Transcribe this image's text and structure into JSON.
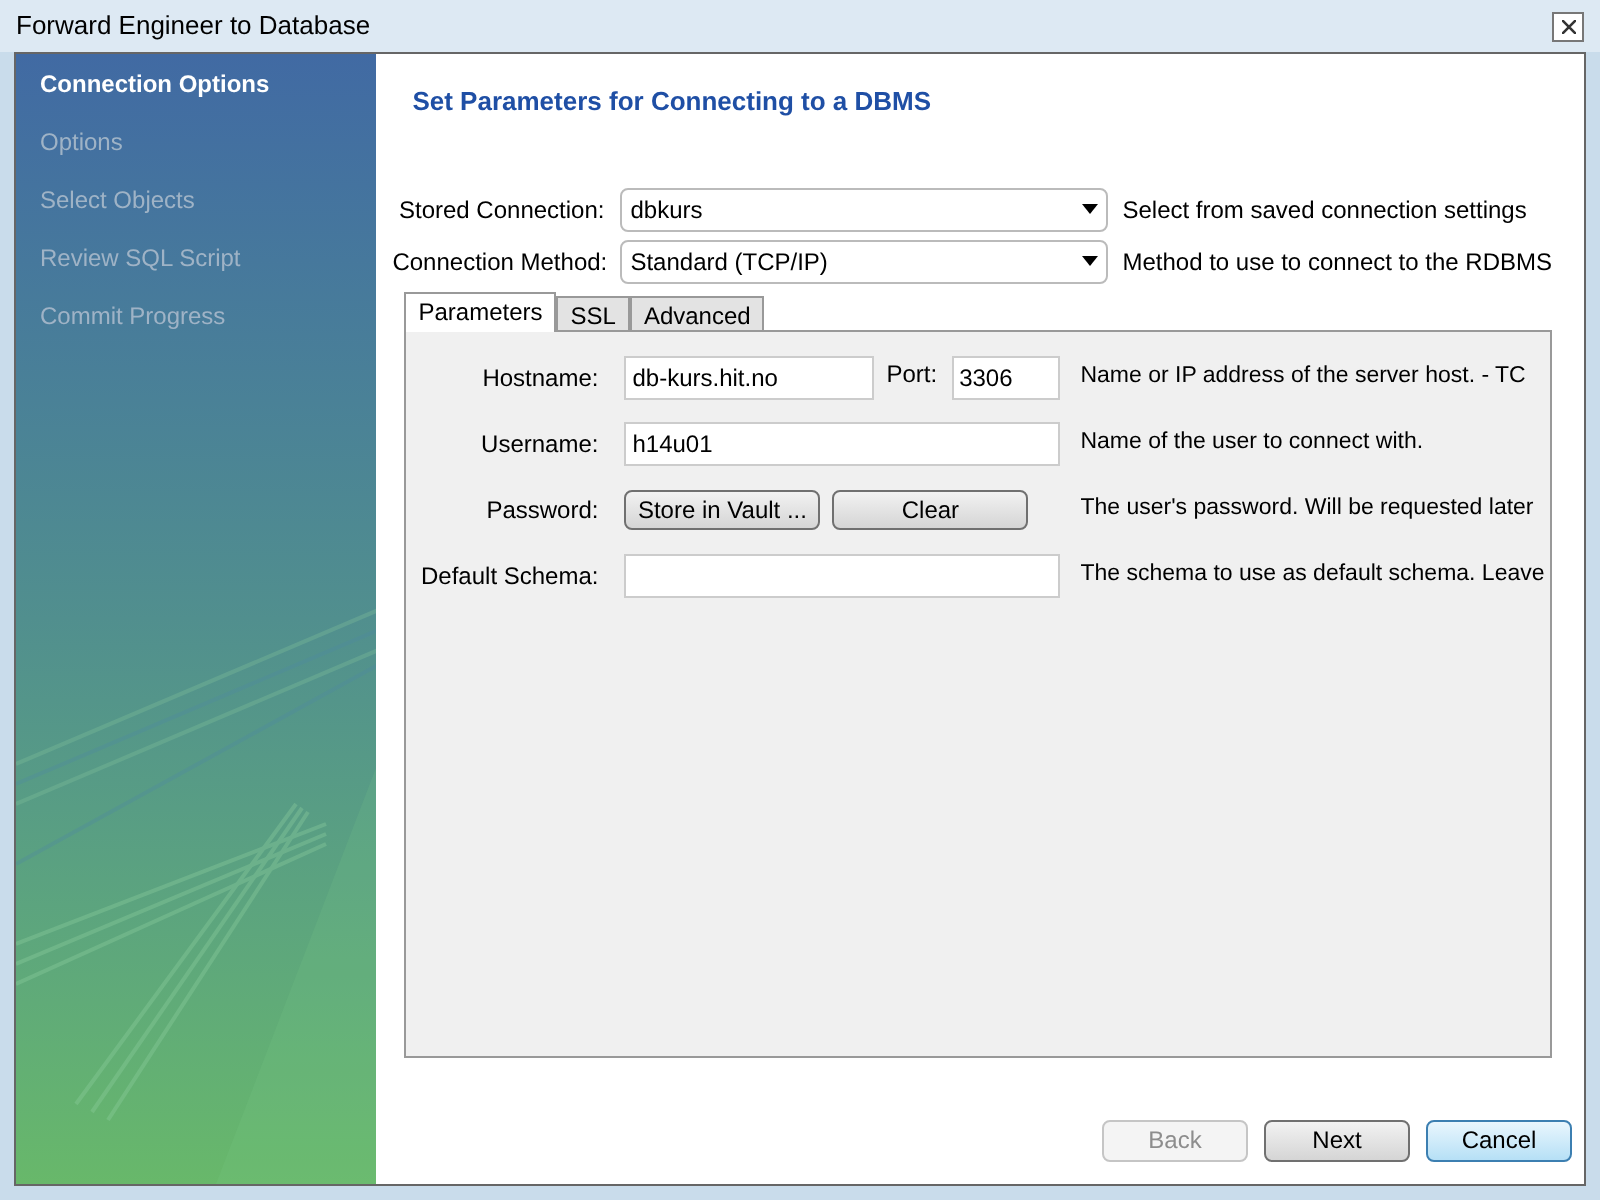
{
  "window": {
    "title": "Forward Engineer to Database"
  },
  "sidebar": {
    "items": [
      {
        "label": "Connection Options",
        "selected": true
      },
      {
        "label": "Options",
        "selected": false
      },
      {
        "label": "Select Objects",
        "selected": false
      },
      {
        "label": "Review SQL Script",
        "selected": false
      },
      {
        "label": "Commit Progress",
        "selected": false
      }
    ]
  },
  "heading": "Set Parameters for Connecting to a DBMS",
  "selects": [
    {
      "label": "Stored Connection:",
      "value": "dbkurs",
      "description": "Select from saved connection settings"
    },
    {
      "label": "Connection Method:",
      "value": "Standard (TCP/IP)",
      "description": "Method to use to connect to the RDBMS"
    }
  ],
  "tabs": [
    {
      "label": "Parameters",
      "selected": true
    },
    {
      "label": "SSL",
      "selected": false
    },
    {
      "label": "Advanced",
      "selected": false
    }
  ],
  "parameters": [
    {
      "kind": "hostport",
      "label": "Hostname:",
      "value": "db-kurs.hit.no",
      "port_label": "Port:",
      "port_value": "3306",
      "description": "Name or IP address of the server host. - TC"
    },
    {
      "kind": "text",
      "label": "Username:",
      "value": "h14u01",
      "description": "Name of the user to connect with."
    },
    {
      "kind": "buttons",
      "label": "Password:",
      "buttons": [
        "Store in Vault ...",
        "Clear"
      ],
      "description": "The user's password. Will be requested later"
    },
    {
      "kind": "text",
      "label": "Default Schema:",
      "description": "The schema to use as default schema. Leave"
    }
  ],
  "footer_buttons": [
    {
      "label": "Back",
      "disabled": true,
      "focused": false
    },
    {
      "label": "Next",
      "disabled": false,
      "focused": false
    },
    {
      "label": "Cancel",
      "disabled": false,
      "focused": true
    }
  ]
}
